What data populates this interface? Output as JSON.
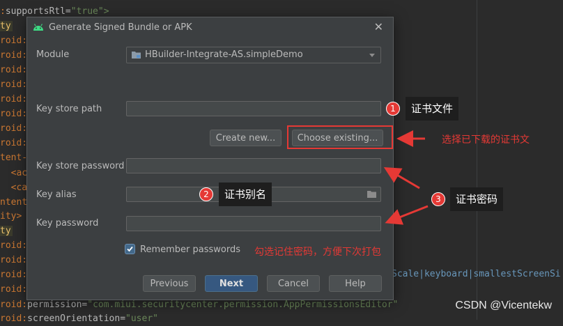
{
  "editor": {
    "lines": [
      {
        "prefix": ":",
        "attr": "supportsRtl",
        "eq": "=",
        "value": "\"true\">",
        "highlight": false
      },
      {
        "prefix": "ty",
        "highlight": true
      },
      {
        "prefix": "roid:",
        "highlight": false
      },
      {
        "prefix": "roid:",
        "highlight": false
      },
      {
        "prefix": "roid:",
        "highlight": false
      },
      {
        "prefix": "roid:",
        "highlight": false
      },
      {
        "prefix": "roid:",
        "highlight": false
      },
      {
        "prefix": "roid:",
        "highlight": false
      },
      {
        "prefix": "roid:",
        "highlight": false
      },
      {
        "prefix": "roid:",
        "highlight": false
      },
      {
        "prefix": "tent-",
        "highlight": false
      },
      {
        "prefix": "  <act",
        "highlight": false
      },
      {
        "prefix": "  <cat",
        "highlight": false
      },
      {
        "prefix": "ntent",
        "highlight": false
      },
      {
        "prefix": "ity>",
        "highlight": false
      },
      {
        "prefix": "ty",
        "highlight": true
      },
      {
        "prefix": "roid:",
        "highlight": false
      },
      {
        "prefix": "roid:",
        "highlight": false
      },
      {
        "prefix": "roid:",
        "highlight": false
      },
      {
        "prefix": "roid:",
        "highlight": false
      },
      {
        "prefix": "roid:",
        "attr": "permission",
        "eq": "=",
        "value": "\"com.miui.securitycenter.permission.AppPermissionsEditor\"",
        "highlight": false
      },
      {
        "prefix": "roid:",
        "attr": "screenOrientation",
        "eq": "=",
        "value": "\"user\"",
        "highlight": false
      }
    ],
    "right_text": "Scale|keyboard|smallestScreenSi"
  },
  "watermark": "CSDN @Vicentekw",
  "dialog": {
    "title": "Generate Signed Bundle or APK",
    "close": "✕",
    "module_label": "Module",
    "module_value": "HBuilder-Integrate-AS.simpleDemo",
    "keystore_path_label": "Key store path",
    "keystore_path_value": "",
    "create_new": "Create new...",
    "choose_existing": "Choose existing...",
    "keystore_password_label": "Key store password",
    "keystore_password_value": "",
    "key_alias_label": "Key alias",
    "key_alias_value": "",
    "key_password_label": "Key password",
    "key_password_value": "",
    "remember_label": "Remember passwords",
    "remember_checked": true,
    "buttons": {
      "previous": "Previous",
      "next": "Next",
      "cancel": "Cancel",
      "help": "Help"
    }
  },
  "annotations": {
    "n1": "1",
    "tag1": "证书文件",
    "note_choose": "选择已下载的证书文",
    "n2": "2",
    "tag2": "证书别名",
    "n3": "3",
    "tag3": "证书密码",
    "note_remember": "勾选记住密码，方便下次打包"
  },
  "colors": {
    "dialog_bg": "#3c3f41",
    "primary_button": "#365880",
    "annotation_red": "#e53935"
  }
}
